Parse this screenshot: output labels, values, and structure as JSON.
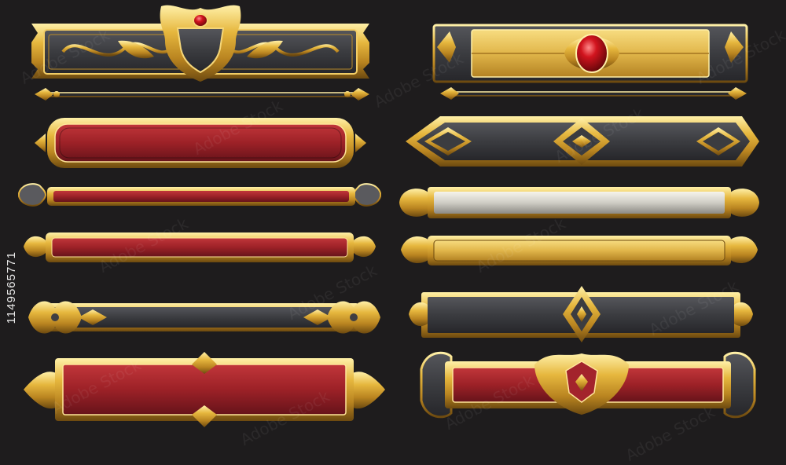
{
  "stock": {
    "id": "1149565771",
    "watermark": "Adobe Stock"
  },
  "colors": {
    "background": "#1e1c1d",
    "gold_light": "#f6dd84",
    "gold": "#d9a930",
    "gold_dark": "#7a5412",
    "red": "#a3242c",
    "red_dark": "#5b1013",
    "charcoal": "#3e3e42",
    "charcoal_dark": "#222225",
    "silver": "#dcdad2",
    "gem": "#b5121b"
  },
  "banners": [
    {
      "id": "b1",
      "fill": "charcoal",
      "style": "crest-crown",
      "gem": true
    },
    {
      "id": "b2",
      "fill": "gold",
      "style": "gem-center",
      "gem": true
    },
    {
      "id": "b3",
      "fill": "none",
      "style": "thin-rod",
      "gem": false
    },
    {
      "id": "b4",
      "fill": "none",
      "style": "thin-rod",
      "gem": false
    },
    {
      "id": "b5",
      "fill": "red",
      "style": "rounded-caps",
      "gem": false
    },
    {
      "id": "b6",
      "fill": "charcoal",
      "style": "diamond-arrows",
      "gem": false
    },
    {
      "id": "b7",
      "fill": "red",
      "style": "scroll-caps",
      "gem": false
    },
    {
      "id": "b8",
      "fill": "silver",
      "style": "scroll-caps",
      "gem": false
    },
    {
      "id": "b9",
      "fill": "red",
      "style": "fleur-caps",
      "gem": false
    },
    {
      "id": "b10",
      "fill": "gold",
      "style": "fleur-caps",
      "gem": false
    },
    {
      "id": "b11",
      "fill": "charcoal",
      "style": "cross-ornaments",
      "gem": false
    },
    {
      "id": "b12",
      "fill": "charcoal",
      "style": "diamond-center",
      "gem": false
    },
    {
      "id": "b13",
      "fill": "red",
      "style": "wing-caps",
      "gem": false
    },
    {
      "id": "b14",
      "fill": "red",
      "style": "crest-center",
      "gem": false
    }
  ]
}
